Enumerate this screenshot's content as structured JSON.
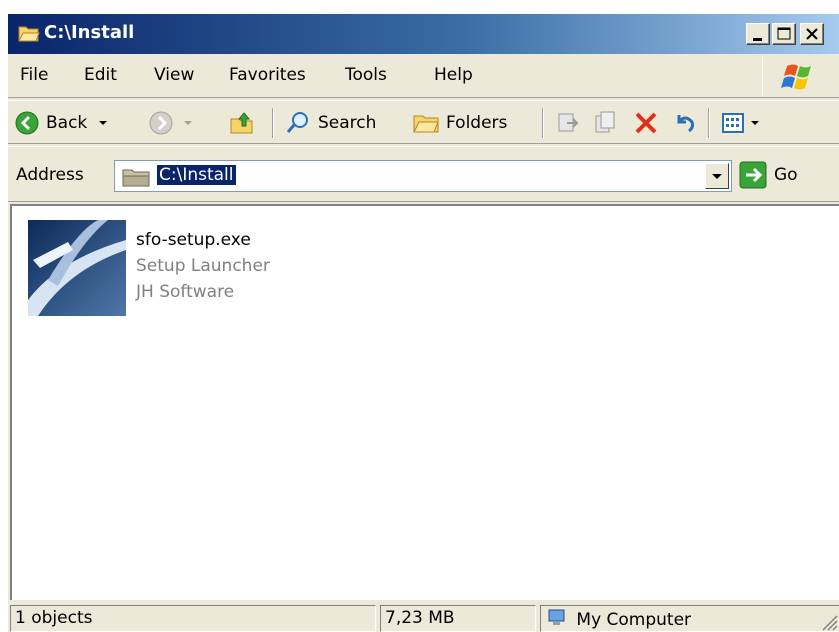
{
  "window": {
    "title": "C:\\Install",
    "title_icon": "folder-open-icon"
  },
  "menu": {
    "items": [
      "File",
      "Edit",
      "View",
      "Favorites",
      "Tools",
      "Help"
    ]
  },
  "toolbar": {
    "back_label": "Back",
    "search_label": "Search",
    "folders_label": "Folders"
  },
  "address": {
    "label": "Address",
    "value": "C:\\Install",
    "go_label": "Go"
  },
  "file": {
    "name": "sfo-setup.exe",
    "description": "Setup Launcher",
    "company": "JH Software"
  },
  "status": {
    "objects": "1 objects",
    "size": "7,23 MB",
    "zone": "My Computer"
  },
  "colors": {
    "title_start": "#0a246a",
    "title_end": "#a6caf0",
    "selection": "#0a246a",
    "chrome": "#ece9d8"
  }
}
